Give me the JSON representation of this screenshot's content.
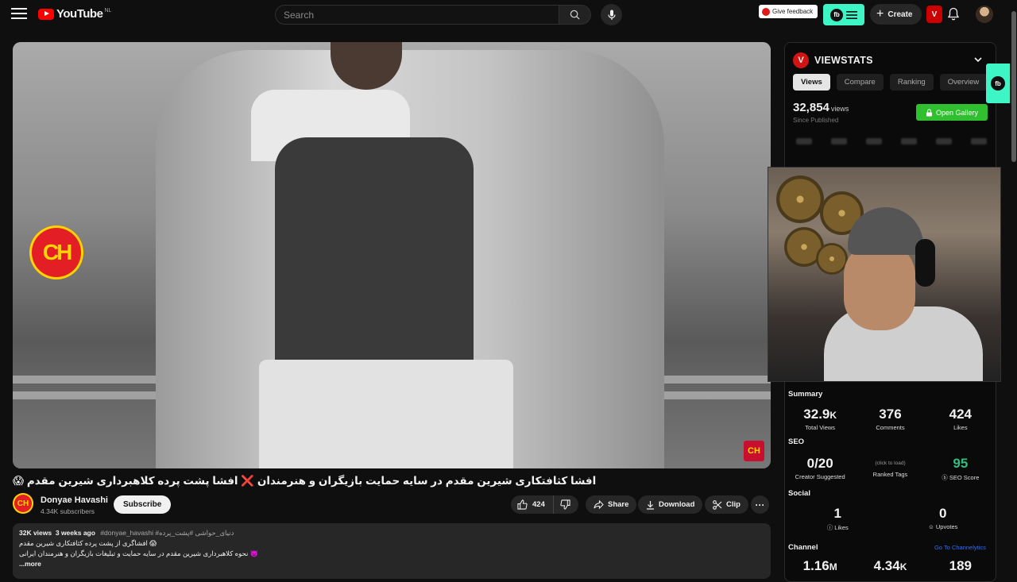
{
  "header": {
    "logo_text": "YouTube",
    "region": "NL",
    "search_placeholder": "Search",
    "feedback_label": "Give feedback",
    "create_label": "Create",
    "ext_badge": "V",
    "fb_logo": "fb"
  },
  "video": {
    "title": "افشا کثافتکاری شیرین مقدم در سایه حمایت بازیگران و هنرمندان ❌ افشا پشت پرده کلاهبرداری شیرین مقدم 😱",
    "watermark": "CH",
    "logo": "CH"
  },
  "channel": {
    "name": "Donyae Havashi",
    "subscribers": "4.34K subscribers",
    "avatar": "CH",
    "subscribe_label": "Subscribe"
  },
  "actions": {
    "likes": "424",
    "share": "Share",
    "download": "Download",
    "clip": "Clip",
    "more": "···"
  },
  "description": {
    "views": "32K views",
    "age": "3 weeks ago",
    "tags": "#donyae_havashi #دنیای_حواشی #پشت_پرده",
    "line1": "افشاگری از پشت پرده کثافتکاری شیرین مقدم 😱",
    "line2": "نحوه کلاهبرداری شیرین مقدم در سایه حمایت و تبلیغات بازیگران و هنرمندان ایرانی 👿",
    "more": "...more"
  },
  "viewstats": {
    "badge": "V",
    "title": "VIEWSTATS",
    "tabs": [
      {
        "label": "Views"
      },
      {
        "label": "Compare"
      },
      {
        "label": "Ranking"
      },
      {
        "label": "Overview"
      }
    ],
    "views": "32,854",
    "views_unit": "views",
    "since": "Since Published",
    "gallery": "Open Gallery",
    "summary_label": "Summary",
    "summary": [
      {
        "num": "32.9",
        "unit": "K",
        "label": "Total Views"
      },
      {
        "num": "376",
        "unit": "",
        "label": "Comments"
      },
      {
        "num": "424",
        "unit": "",
        "label": "Likes"
      }
    ],
    "seo_label": "SEO",
    "seo": {
      "creator_num": "0/20",
      "creator_label": "Creator Suggested",
      "ranked_hint": "(click to load)",
      "ranked_label": "Ranked Tags",
      "score_num": "95",
      "score_label": "SEO Score"
    },
    "social_label": "Social",
    "social": [
      {
        "num": "1",
        "label": "Likes"
      },
      {
        "num": "0",
        "label": "Upvotes"
      }
    ],
    "channel_label": "Channel",
    "channel_link": "Go To Channelytics",
    "channel_stats": [
      {
        "num": "1.16",
        "unit": "M"
      },
      {
        "num": "4.34",
        "unit": "K"
      },
      {
        "num": "189",
        "unit": ""
      }
    ]
  },
  "colors": {
    "youtube_red": "#ff0000",
    "viewstats_red": "#d01414",
    "fb_teal": "#3ef5c6",
    "gallery_green": "#2fbf2f",
    "seo_green": "#2fbf7f"
  }
}
